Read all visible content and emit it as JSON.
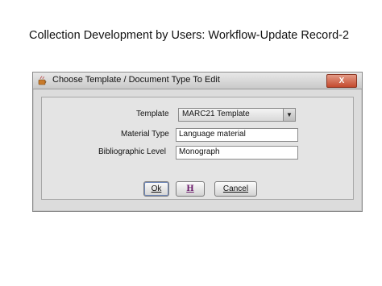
{
  "slide": {
    "title": "Collection Development by Users: Workflow-Update Record-2"
  },
  "dialog": {
    "title": "Choose Template / Document Type To Edit",
    "close_label": "X",
    "fields": {
      "template_label": "Template",
      "template_value": "MARC21 Template",
      "material_type_label": "Material Type",
      "material_type_value": "Language material",
      "bibliographic_level_label": "Bibliographic Level",
      "bibliographic_level_value": "Monograph"
    },
    "buttons": {
      "ok_label": "Ok",
      "hindi_label": "H",
      "cancel_label": "Cancel"
    }
  }
}
